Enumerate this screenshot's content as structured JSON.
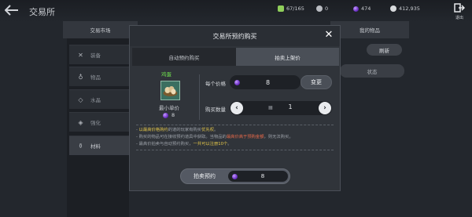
{
  "header": {
    "title": "交易所",
    "capacity": "67/165",
    "currency1": "0",
    "currency2": "474",
    "currency3": "412,935",
    "exit_label": "退出"
  },
  "market": {
    "tab_label": "交易市场",
    "categories": [
      {
        "label": "装备",
        "icon": "sword-icon"
      },
      {
        "label": "物品",
        "icon": "potion-icon"
      },
      {
        "label": "水晶",
        "icon": "crystal-icon"
      },
      {
        "label": "强化",
        "icon": "gem-icon"
      },
      {
        "label": "材料",
        "icon": "bottle-icon"
      }
    ]
  },
  "my_items": {
    "tab_label": "我的物品",
    "refresh_label": "刷新",
    "status_label": "状态"
  },
  "modal": {
    "title": "交易所预约购买",
    "tabs": [
      "自动预约购买",
      "拍卖上架价"
    ],
    "item_name": "鸡蛋",
    "min_price_label": "最小单价",
    "min_price_value": "8",
    "unit_price_label": "每个价格",
    "unit_price_value": "8",
    "change_label": "变更",
    "qty_label": "购买数量",
    "qty_value": "1",
    "notes": {
      "l1_prefix": "- ",
      "l1_hl": "以最高价格购约",
      "l1_mid": "的道的玩家有购买",
      "l1_hl2": "优先权",
      "l1_end": "。",
      "l2_a": "- 购买的物品可在接收预约道具中获取。当物品的",
      "l2_hl": "最高价高于预购金额",
      "l2_b": "，则无法购买。",
      "l3_a": "- 最高价拍卖与自动预约购买，",
      "l3_hl": "一共可以注册10个",
      "l3_b": "。"
    },
    "bid_label": "拍卖预约",
    "bid_value": "8"
  },
  "colors": {
    "gem": "#7b3fd8",
    "highlight_yellow": "#e6c84a",
    "highlight_red": "#e86a4a",
    "item_name": "#6fe04e"
  }
}
